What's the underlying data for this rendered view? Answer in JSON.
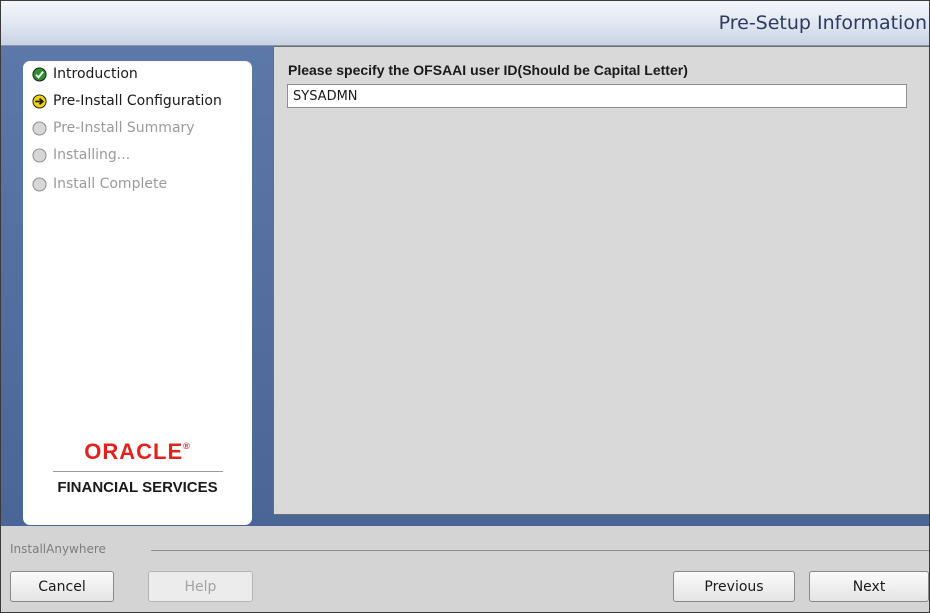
{
  "window": {
    "header_title": "Pre-Setup Information"
  },
  "steps": [
    {
      "label": "Introduction",
      "state": "done",
      "icon": "check-circle-icon"
    },
    {
      "label": "Pre-Install Configuration",
      "state": "current",
      "icon": "arrow-circle-icon"
    },
    {
      "label": "Pre-Install Summary",
      "state": "pending",
      "icon": "empty-circle-icon"
    },
    {
      "label": "Installing...",
      "state": "pending",
      "icon": "empty-circle-icon"
    },
    {
      "label": "Install Complete",
      "state": "pending",
      "icon": "empty-circle-icon"
    }
  ],
  "logo": {
    "brand": "ORACLE",
    "mark": "®",
    "subtitle": "FINANCIAL SERVICES"
  },
  "form": {
    "label": "Please specify the OFSAAI user ID(Should be Capital Letter)",
    "value": "SYSADMN"
  },
  "footer": {
    "vendor": "InstallAnywhere",
    "cancel": "Cancel",
    "help": "Help",
    "previous": "Previous",
    "next": "Next"
  },
  "colors": {
    "accent_blue": "#4a6696",
    "oracle_red": "#e3221d",
    "done_green": "#2f8f2f",
    "current_yellow": "#f2d20b"
  }
}
